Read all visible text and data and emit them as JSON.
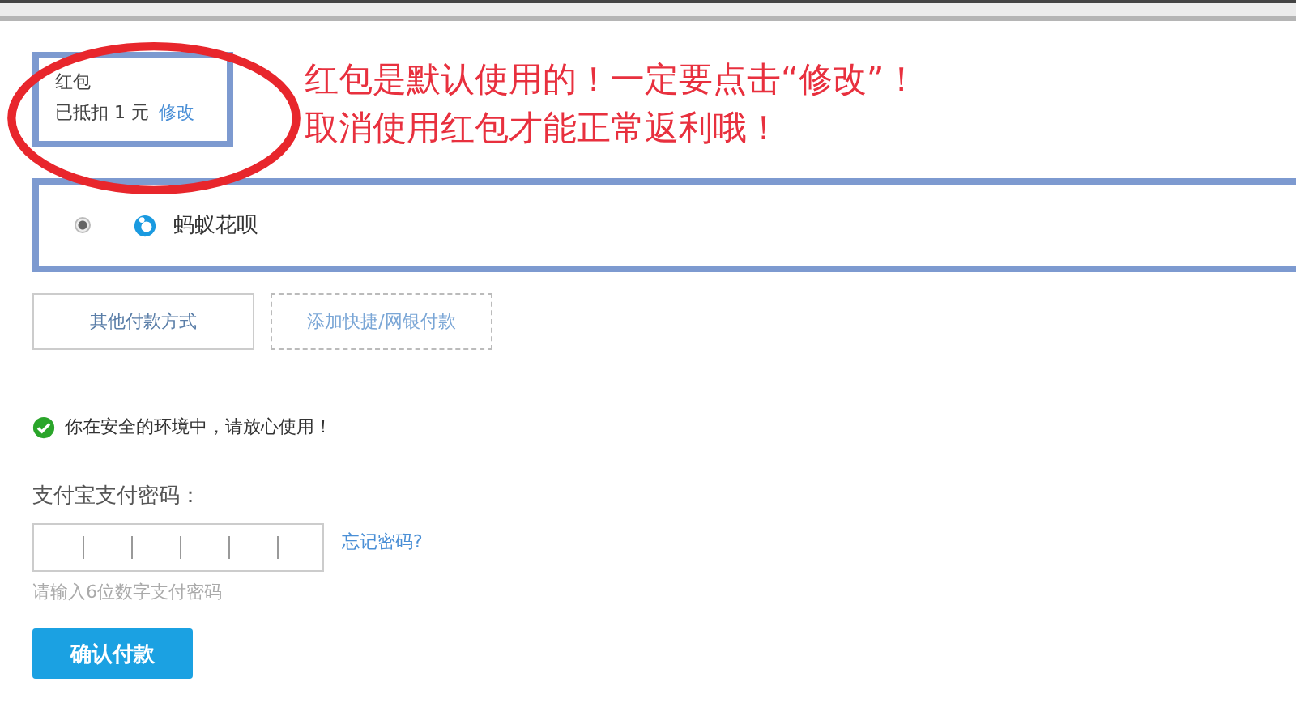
{
  "red_packet": {
    "title": "红包",
    "amount_text": "已抵扣 1 元",
    "edit_link": "修改"
  },
  "annotation": [
    "红包是默认使用的！一定要点击“修改”！",
    "取消使用红包才能正常返利哦！"
  ],
  "payment_methods": [
    {
      "label": "蚂蚁花呗",
      "selected": true
    }
  ],
  "buttons": [
    {
      "label": "其他付款方式",
      "kind": "solid"
    },
    {
      "label": "添加快捷/网银付款",
      "kind": "dashed"
    }
  ],
  "security_notice": "你在安全的环境中，请放心使用！",
  "password": {
    "label": "支付宝支付密码：",
    "forgot_link": "忘记密码?",
    "hint": "请输入6位数字支付密码"
  },
  "confirm_button": "确认付款"
}
